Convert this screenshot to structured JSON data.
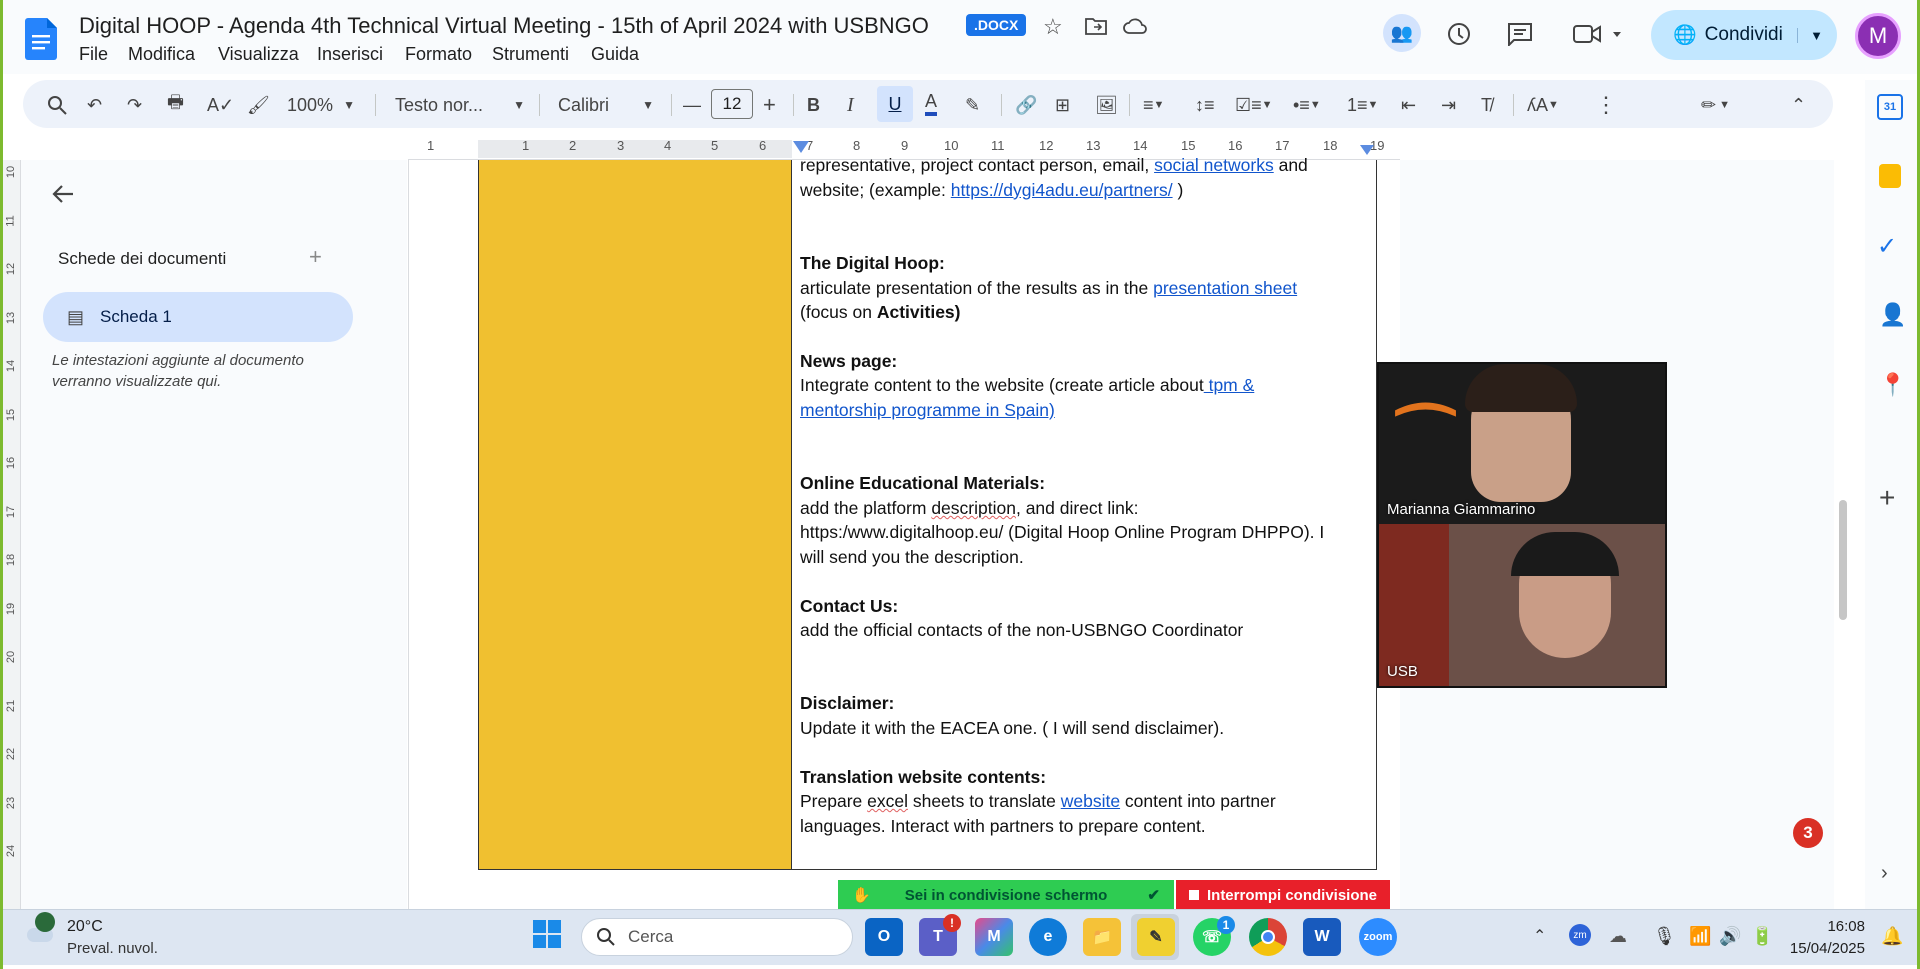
{
  "app": {
    "title": "Digital HOOP - Agenda 4th Technical Virtual Meeting - 15th of April 2024 with USBNGO",
    "badge": ".DOCX",
    "share_label": "Condividi",
    "avatar_initial": "M"
  },
  "menu": [
    "File",
    "Modifica",
    "Visualizza",
    "Inserisci",
    "Formato",
    "Strumenti",
    "Guida"
  ],
  "toolbar": {
    "zoom": "100%",
    "style": "Testo nor...",
    "font": "Calibri",
    "font_size": "12"
  },
  "ruler": [
    "1",
    "1",
    "2",
    "3",
    "4",
    "5",
    "6",
    "7",
    "8",
    "9",
    "10",
    "11",
    "12",
    "13",
    "14",
    "15",
    "16",
    "17",
    "18",
    "19"
  ],
  "vruler": [
    "10",
    "11",
    "12",
    "13",
    "14",
    "15",
    "16",
    "17",
    "18",
    "19",
    "20",
    "21",
    "22",
    "23",
    "24"
  ],
  "sidebar": {
    "heading": "Schede dei documenti",
    "tab": "Scheda 1",
    "note_line1": "Le intestazioni aggiunte al documento",
    "note_line2": "verranno visualizzate qui."
  },
  "doc": {
    "l1a": "representative, project contact person, email, ",
    "l1link": "social networks",
    "l1b": " and",
    "l2a": "website; (example: ",
    "l2link": "https://dygi4adu.eu/partners/",
    "l2b": " )",
    "h1": "The Digital Hoop:",
    "l3a": "articulate presentation of the results as in the ",
    "l3link": "presentation sheet",
    "l4a": "(focus on ",
    "l4b": "Activities)",
    "h2": "News page:",
    "l5a": "Integrate content to the website (create article about",
    "l5link": " tpm &",
    "l6link": "mentorship programme in Spain)",
    "h3": "Online Educational Materials:",
    "l7a": "add the platform ",
    "l7sq": "description",
    ", and direct link:": "",
    "l7b": ", and direct link:",
    "l8": "https:/www.digitalhoop.eu/ (Digital Hoop Online Program DHPPO). I",
    "l9": "will send you the description.",
    "h4": "Contact Us:",
    "l10": "add the official contacts of the non-USBNGO Coordinator",
    "h5": "Disclaimer:",
    "l11": "Update it with the EACEA one. ( I will send disclaimer).",
    "h6": "Translation website contents:",
    "l12a": "Prepare ",
    "l12sq": "excel",
    "l12b": " sheets to translate ",
    "l12link": "website",
    "l12c": " content into partner",
    "l13": "languages. Interact with partners to prepare content."
  },
  "video": {
    "p1": "Marianna Giammarino",
    "p2": "USB"
  },
  "notification_count": "3",
  "screenshare": {
    "status": "Sei in condivisione schermo",
    "stop": "Interrompi condivisione"
  },
  "taskbar": {
    "weather_temp": "20°C",
    "weather_desc": "Preval. nuvol.",
    "search": "Cerca",
    "time": "16:08",
    "date": "15/04/2025",
    "teams_badge": "!",
    "whatsapp_badge": "1"
  }
}
